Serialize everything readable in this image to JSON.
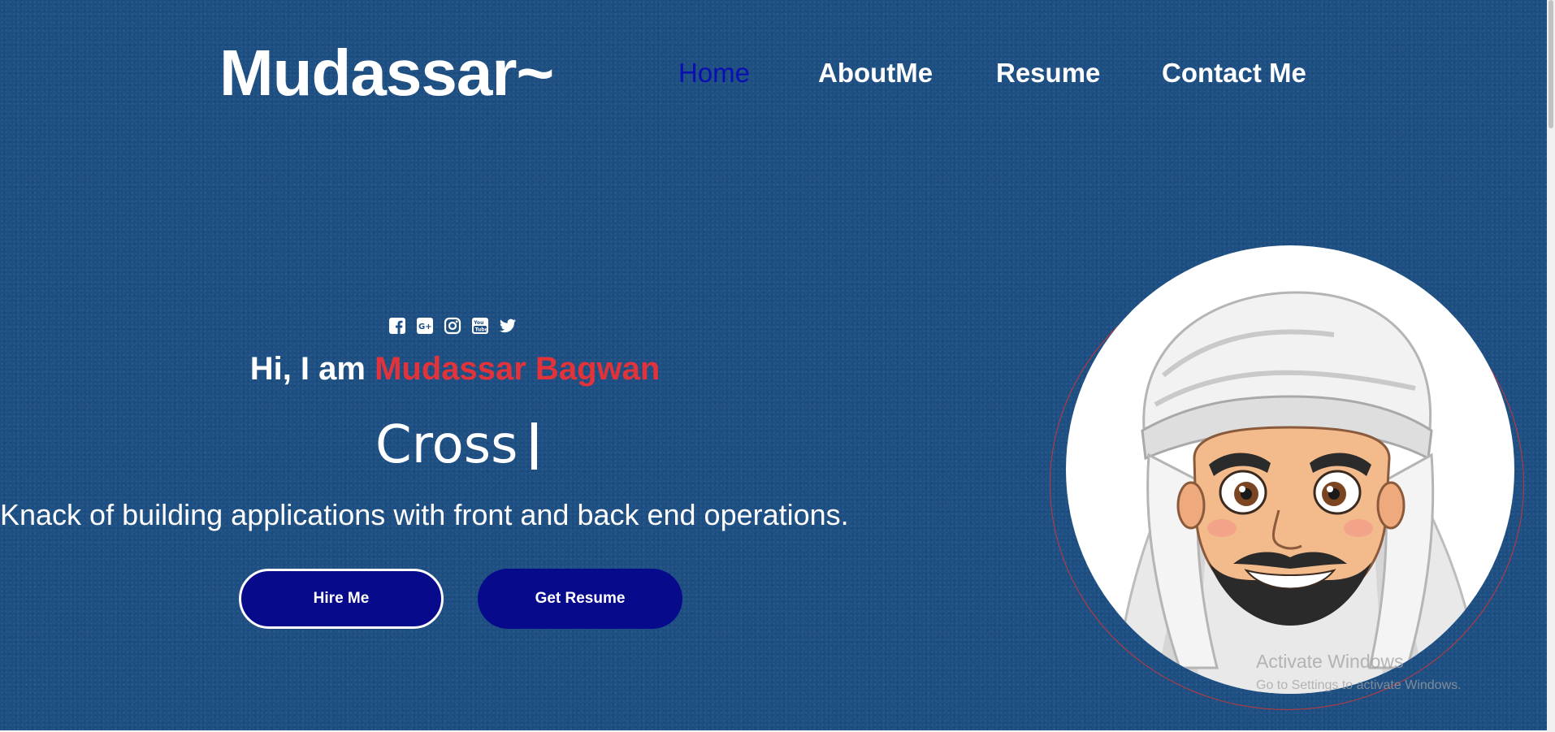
{
  "brand": {
    "logo": "Mudassar~"
  },
  "nav": {
    "items": [
      {
        "label": "Home",
        "active": true
      },
      {
        "label": "AboutMe",
        "active": false
      },
      {
        "label": "Resume",
        "active": false
      },
      {
        "label": "Contact Me",
        "active": false
      }
    ]
  },
  "hero": {
    "social_icons": [
      "facebook-icon",
      "google-plus-icon",
      "instagram-icon",
      "youtube-icon",
      "twitter-icon"
    ],
    "greeting_prefix": "Hi, I am ",
    "greeting_name": "Mudassar Bagwan",
    "typed_text": "Cross",
    "tagline": "Knack of building applications with front and back end operations.",
    "buttons": {
      "hire": "Hire Me",
      "resume": "Get Resume"
    },
    "avatar": "avatar-illustration"
  },
  "watermark": {
    "title": "Activate Windows",
    "subtitle": "Go to Settings to activate Windows."
  },
  "colors": {
    "background": "#1d4f83",
    "accent_red": "#e2333a",
    "button_navy": "#080a8c",
    "nav_active": "#0a0fb0"
  }
}
